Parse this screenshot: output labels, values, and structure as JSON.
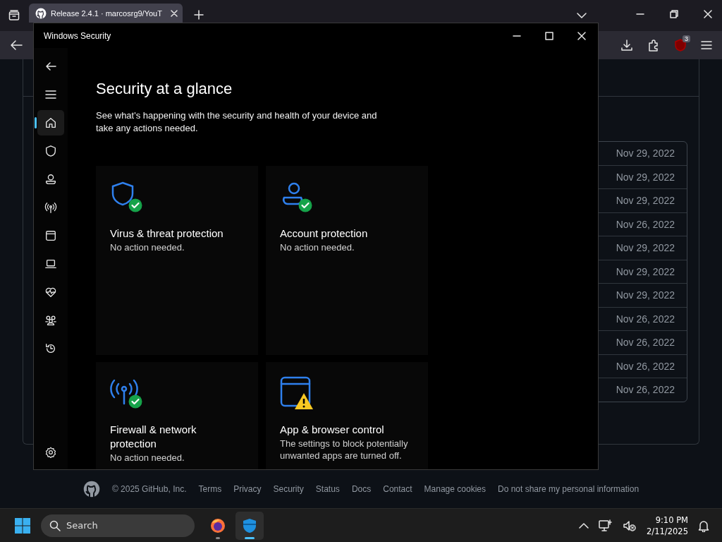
{
  "browser": {
    "tab": {
      "title": "Release 2.4.1 · marcosrg9/YouT"
    },
    "extension_badge": "3",
    "dates": [
      "Nov 29, 2022",
      "Nov 29, 2022",
      "Nov 29, 2022",
      "Nov 26, 2022",
      "Nov 29, 2022",
      "Nov 29, 2022",
      "Nov 29, 2022",
      "Nov 26, 2022",
      "Nov 26, 2022",
      "Nov 26, 2022",
      "Nov 26, 2022"
    ],
    "footer": {
      "copyright": "© 2025 GitHub, Inc.",
      "links": [
        "Terms",
        "Privacy",
        "Security",
        "Status",
        "Docs",
        "Contact",
        "Manage cookies",
        "Do not share my personal information"
      ]
    }
  },
  "security_window": {
    "title": "Windows Security",
    "nav_items": [
      {
        "selected": true
      },
      {
        "selected": false
      },
      {
        "selected": false
      },
      {
        "selected": false
      },
      {
        "selected": false
      },
      {
        "selected": false
      },
      {
        "selected": false
      },
      {
        "selected": false
      },
      {
        "selected": false
      }
    ],
    "heading": "Security at a glance",
    "description": "See what's happening with the security and health of your device and take any actions needed.",
    "cards": [
      {
        "title": "Virus & threat protection",
        "status_text": "No action needed.",
        "kind": "ok"
      },
      {
        "title": "Account protection",
        "status_text": "No action needed.",
        "kind": "ok"
      },
      {
        "title": "Firewall & network protection",
        "status_text": "No action needed.",
        "kind": "ok"
      },
      {
        "title": "App & browser control",
        "status_text": "The settings to block potentially unwanted apps are turned off.",
        "kind": "warning"
      }
    ]
  },
  "taskbar": {
    "search": {
      "placeholder": "Search"
    },
    "apps": [
      {
        "selected": false
      },
      {
        "selected": true
      }
    ],
    "time": "9:10 PM",
    "date": "2/11/2025"
  }
}
